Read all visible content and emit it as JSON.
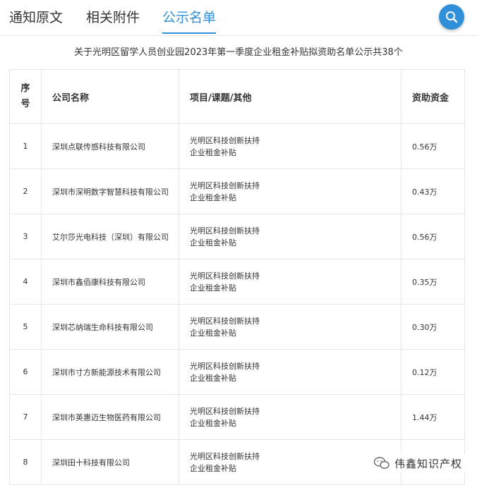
{
  "tabs": [
    {
      "label": "通知原文"
    },
    {
      "label": "相关附件"
    },
    {
      "label": "公示名单"
    }
  ],
  "heading": "关于光明区留学人员创业园2023年第一季度企业租金补贴拟资助名单公示共38个",
  "table": {
    "headers": {
      "index": "序号",
      "company": "公司名称",
      "project": "项目/课题/其他",
      "amount": "资助资金"
    },
    "rows": [
      {
        "index": "1",
        "company": "深圳点联传感科技有限公司",
        "project_line1": "光明区科技创新扶持",
        "project_line2": "企业租金补贴",
        "amount": "0.56万"
      },
      {
        "index": "2",
        "company": "深圳市深明数字智慧科技有限公司",
        "project_line1": "光明区科技创新扶持",
        "project_line2": "企业租金补贴",
        "amount": "0.43万"
      },
      {
        "index": "3",
        "company": "艾尔莎光电科技（深圳）有限公司",
        "project_line1": "光明区科技创新扶持",
        "project_line2": "企业租金补贴",
        "amount": "0.56万"
      },
      {
        "index": "4",
        "company": "深圳市鑫佰康科技有限公司",
        "project_line1": "光明区科技创新扶持",
        "project_line2": "企业租金补贴",
        "amount": "0.35万"
      },
      {
        "index": "5",
        "company": "深圳芯纳瑞生命科技有限公司",
        "project_line1": "光明区科技创新扶持",
        "project_line2": "企业租金补贴",
        "amount": "0.30万"
      },
      {
        "index": "6",
        "company": "深圳市寸方新能源技术有限公司",
        "project_line1": "光明区科技创新扶持",
        "project_line2": "企业租金补贴",
        "amount": "0.12万"
      },
      {
        "index": "7",
        "company": "深圳市英惠迈生物医药有限公司",
        "project_line1": "光明区科技创新扶持",
        "project_line2": "企业租金补贴",
        "amount": "1.44万"
      },
      {
        "index": "8",
        "company": "深圳田十科技有限公司",
        "project_line1": "光明区科技创新扶持",
        "project_line2": "企业租金补贴",
        "amount": ""
      }
    ]
  },
  "watermark": {
    "text": "伟鑫知识产权",
    "icon": "wechat-icon"
  },
  "colors": {
    "accent": "#2f8fd8",
    "text": "#333333",
    "border": "#e5e5e5"
  }
}
